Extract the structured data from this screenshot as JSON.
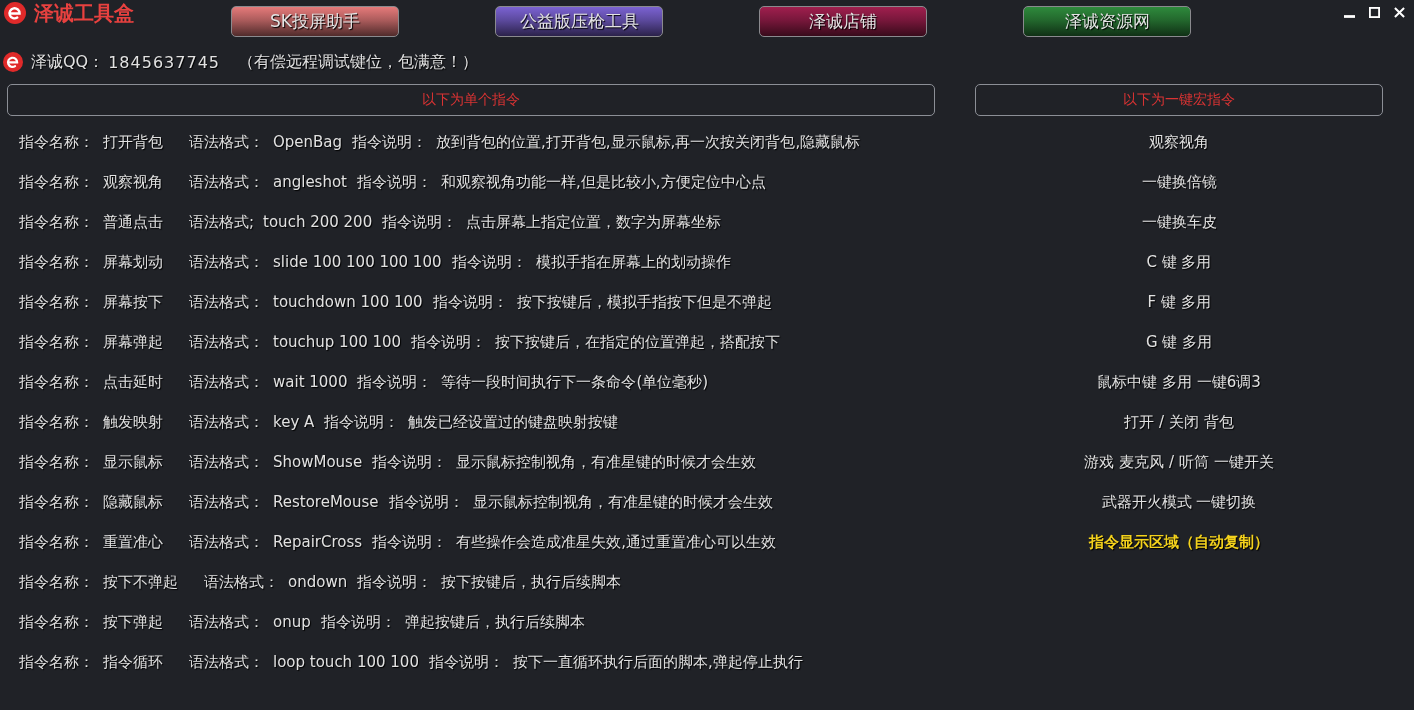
{
  "app": {
    "title": "泽诚工具盒"
  },
  "top_buttons": [
    {
      "label": "SK投屏助手",
      "color": "#e57a7a"
    },
    {
      "label": "公益版压枪工具",
      "color": "#7b62d2"
    },
    {
      "label": "泽诚店铺",
      "color": "#a01f4e"
    },
    {
      "label": "泽诚资源网",
      "color": "#2e8a3c"
    }
  ],
  "contact": {
    "label": "泽诚QQ：",
    "number": "1845637745",
    "note": "（有偿远程调试键位，包满意！）"
  },
  "single_commands": {
    "header": "以下为单个指令",
    "rows": [
      {
        "name_label": "指令名称：",
        "name": "打开背包",
        "syntax_label": "语法格式：",
        "syntax": "OpenBag",
        "description_label": "指令说明：",
        "description": "放到背包的位置,打开背包,显示鼠标,再一次按关闭背包,隐藏鼠标"
      },
      {
        "name_label": "指令名称：",
        "name": "观察视角",
        "syntax_label": "语法格式：",
        "syntax": "angleshot",
        "description_label": "指令说明：",
        "description": "和观察视角功能一样,但是比较小,方便定位中心点"
      },
      {
        "name_label": "指令名称：",
        "name": "普通点击",
        "syntax_label": "语法格式;",
        "syntax": "touch 200 200",
        "description_label": "指令说明：",
        "description": "点击屏幕上指定位置，数字为屏幕坐标"
      },
      {
        "name_label": "指令名称：",
        "name": "屏幕划动",
        "syntax_label": "语法格式：",
        "syntax": "slide 100 100 100 100",
        "description_label": "指令说明：",
        "description": "模拟手指在屏幕上的划动操作"
      },
      {
        "name_label": "指令名称：",
        "name": "屏幕按下",
        "syntax_label": "语法格式：",
        "syntax": "touchdown 100 100",
        "description_label": "指令说明：",
        "description": "按下按键后，模拟手指按下但是不弹起"
      },
      {
        "name_label": "指令名称：",
        "name": "屏幕弹起",
        "syntax_label": "语法格式：",
        "syntax": "touchup 100 100",
        "description_label": "指令说明：",
        "description": "按下按键后，在指定的位置弹起，搭配按下"
      },
      {
        "name_label": "指令名称：",
        "name": "点击延时",
        "syntax_label": "语法格式：",
        "syntax": "wait 1000",
        "description_label": "指令说明：",
        "description": "等待一段时间执行下一条命令(单位毫秒)"
      },
      {
        "name_label": "指令名称：",
        "name": "触发映射",
        "syntax_label": "语法格式：",
        "syntax": "key A",
        "description_label": "指令说明：",
        "description": "触发已经设置过的键盘映射按键"
      },
      {
        "name_label": "指令名称：",
        "name": "显示鼠标",
        "syntax_label": "语法格式：",
        "syntax": "ShowMouse",
        "description_label": "指令说明：",
        "description": "显示鼠标控制视角，有准星键的时候才会生效"
      },
      {
        "name_label": "指令名称：",
        "name": "隐藏鼠标",
        "syntax_label": "语法格式：",
        "syntax": "RestoreMouse",
        "description_label": "指令说明：",
        "description": "显示鼠标控制视角，有准星键的时候才会生效"
      },
      {
        "name_label": "指令名称：",
        "name": "重置准心",
        "syntax_label": "语法格式：",
        "syntax": "RepairCross",
        "description_label": "指令说明：",
        "description": "有些操作会造成准星失效,通过重置准心可以生效"
      },
      {
        "name_label": "指令名称：",
        "name": "按下不弹起",
        "syntax_label": "语法格式：",
        "syntax": "ondown",
        "description_label": "指令说明：",
        "description": "按下按键后，执行后续脚本"
      },
      {
        "name_label": "指令名称：",
        "name": "按下弹起",
        "syntax_label": "语法格式：",
        "syntax": "onup",
        "description_label": "指令说明：",
        "description": "弹起按键后，执行后续脚本"
      },
      {
        "name_label": "指令名称：",
        "name": "指令循环",
        "syntax_label": "语法格式：",
        "syntax": "loop touch 100 100",
        "description_label": "指令说明：",
        "description": "按下一直循环执行后面的脚本,弹起停止执行"
      }
    ]
  },
  "macro_commands": {
    "header": "以下为一键宏指令",
    "items": [
      {
        "kind": "macro",
        "label": "观察视角"
      },
      {
        "kind": "macro",
        "label": "一键换倍镜"
      },
      {
        "kind": "macro",
        "label": "一键换车皮"
      },
      {
        "kind": "macro",
        "label": "C 键 多用"
      },
      {
        "kind": "macro",
        "label": "F 键 多用"
      },
      {
        "kind": "macro",
        "label": "G 键 多用"
      },
      {
        "kind": "macro",
        "label": "鼠标中键 多用 一键6调3"
      },
      {
        "kind": "macro",
        "label": "打开 / 关闭 背包"
      },
      {
        "kind": "macro",
        "label": "游戏 麦克风 / 听筒 一键开关"
      },
      {
        "kind": "macro",
        "label": "武器开火模式 一键切换"
      },
      {
        "kind": "display",
        "label": "指令显示区域（自动复制）"
      }
    ]
  }
}
